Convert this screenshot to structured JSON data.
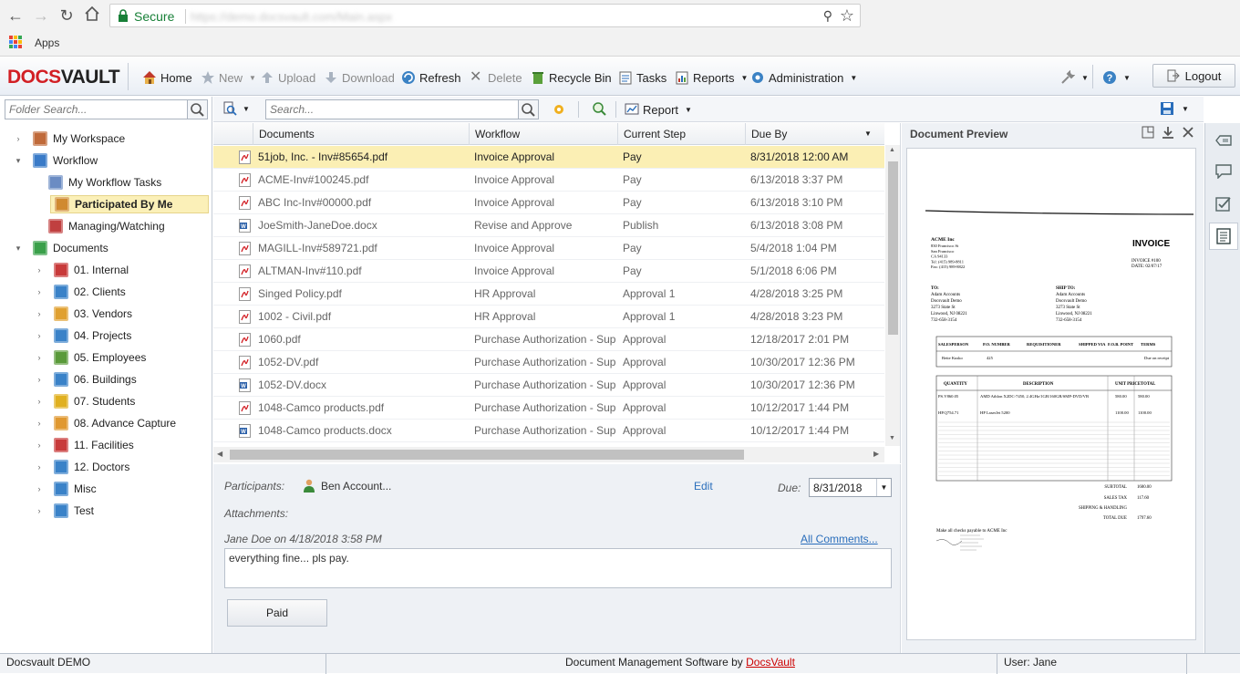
{
  "browser": {
    "secure_label": "Secure",
    "url": "https://demo.docsvault.com/Main.aspx",
    "apps_label": "Apps"
  },
  "app": {
    "logo_docs": "DOCS",
    "logo_vault": "VAULT",
    "toolbar": {
      "home": "Home",
      "new": "New",
      "upload": "Upload",
      "download": "Download",
      "refresh": "Refresh",
      "delete": "Delete",
      "recycle_bin": "Recycle Bin",
      "tasks": "Tasks",
      "reports": "Reports",
      "administration": "Administration",
      "logout": "Logout"
    }
  },
  "left_panel": {
    "search_placeholder": "Folder Search...",
    "tree": [
      {
        "label": "My Workspace",
        "arrow": "›",
        "level": 0,
        "color": "#c06a3a"
      },
      {
        "label": "Workflow",
        "arrow": "⌄",
        "level": 0,
        "color": "#3a7bc8"
      },
      {
        "label": "My Workflow Tasks",
        "arrow": "",
        "level": 1,
        "color": "#6b8cc3"
      },
      {
        "label": "Participated By Me",
        "arrow": "",
        "level": 1,
        "color": "#d08a30",
        "selected": true
      },
      {
        "label": "Managing/Watching",
        "arrow": "",
        "level": 1,
        "color": "#c04040"
      },
      {
        "label": "Documents",
        "arrow": "⌄",
        "level": 0,
        "color": "#3aa04a"
      },
      {
        "label": "01. Internal",
        "arrow": "›",
        "level": 1,
        "color": "#c83a3a"
      },
      {
        "label": "02. Clients",
        "arrow": "›",
        "level": 1,
        "color": "#3a82c8"
      },
      {
        "label": "03. Vendors",
        "arrow": "›",
        "level": 1,
        "color": "#e0a030"
      },
      {
        "label": "04. Projects",
        "arrow": "›",
        "level": 1,
        "color": "#3a82c8"
      },
      {
        "label": "05. Employees",
        "arrow": "›",
        "level": 1,
        "color": "#5a9a3a"
      },
      {
        "label": "06. Buildings",
        "arrow": "›",
        "level": 1,
        "color": "#3a82c8"
      },
      {
        "label": "07. Students",
        "arrow": "›",
        "level": 1,
        "color": "#e0b020"
      },
      {
        "label": "08. Advance Capture",
        "arrow": "›",
        "level": 1,
        "color": "#e09830"
      },
      {
        "label": "11. Facilities",
        "arrow": "›",
        "level": 1,
        "color": "#c83a3a"
      },
      {
        "label": "12. Doctors",
        "arrow": "›",
        "level": 1,
        "color": "#3a82c8"
      },
      {
        "label": "Misc",
        "arrow": "›",
        "level": 1,
        "color": "#3a82c8"
      },
      {
        "label": "Test",
        "arrow": "›",
        "level": 1,
        "color": "#3a82c8"
      }
    ]
  },
  "center_toolbar": {
    "search_placeholder": "Search...",
    "report_label": "Report"
  },
  "grid": {
    "columns": [
      "Documents",
      "Workflow",
      "Current Step",
      "Due By"
    ],
    "rows": [
      {
        "name": "51job, Inc. - Inv#85654.pdf",
        "type": "pdf",
        "workflow": "Invoice Approval",
        "step": "Pay",
        "due": "8/31/2018 12:00 AM",
        "selected": true
      },
      {
        "name": "ACME-Inv#100245.pdf",
        "type": "pdf",
        "workflow": "Invoice Approval",
        "step": "Pay",
        "due": "6/13/2018 3:37 PM"
      },
      {
        "name": "ABC Inc-Inv#00000.pdf",
        "type": "pdf",
        "workflow": "Invoice Approval",
        "step": "Pay",
        "due": "6/13/2018 3:10 PM"
      },
      {
        "name": "JoeSmith-JaneDoe.docx",
        "type": "docx",
        "workflow": "Revise and Approve",
        "step": "Publish",
        "due": "6/13/2018 3:08 PM"
      },
      {
        "name": "MAGILL-Inv#589721.pdf",
        "type": "pdf",
        "workflow": "Invoice Approval",
        "step": "Pay",
        "due": "5/4/2018 1:04 PM"
      },
      {
        "name": "ALTMAN-Inv#110.pdf",
        "type": "pdf",
        "workflow": "Invoice Approval",
        "step": "Pay",
        "due": "5/1/2018 6:06 PM"
      },
      {
        "name": "Singed Policy.pdf",
        "type": "pdf",
        "workflow": "HR Approval",
        "step": "Approval 1",
        "due": "4/28/2018 3:25 PM"
      },
      {
        "name": "1002 - Civil.pdf",
        "type": "pdf",
        "workflow": "HR Approval",
        "step": "Approval 1",
        "due": "4/28/2018 3:23 PM"
      },
      {
        "name": "1060.pdf",
        "type": "pdf",
        "workflow": "Purchase Authorization - Sup",
        "step": "Approval",
        "due": "12/18/2017 2:01 PM"
      },
      {
        "name": "1052-DV.pdf",
        "type": "pdf",
        "workflow": "Purchase Authorization - Sup",
        "step": "Approval",
        "due": "10/30/2017 12:36 PM"
      },
      {
        "name": "1052-DV.docx",
        "type": "docx",
        "workflow": "Purchase Authorization - Sup",
        "step": "Approval",
        "due": "10/30/2017 12:36 PM"
      },
      {
        "name": "1048-Camco products.pdf",
        "type": "pdf",
        "workflow": "Purchase Authorization - Sup",
        "step": "Approval",
        "due": "10/12/2017 1:44 PM"
      },
      {
        "name": "1048-Camco products.docx",
        "type": "docx",
        "workflow": "Purchase Authorization - Sup",
        "step": "Approval",
        "due": "10/12/2017 1:44 PM"
      }
    ]
  },
  "detail": {
    "participants_label": "Participants:",
    "participant_name": "Ben Account...",
    "edit_label": "Edit",
    "due_label": "Due:",
    "due_value": "8/31/2018",
    "attachments_label": "Attachments:",
    "comment_meta": "Jane Doe on 4/18/2018 3:58 PM",
    "all_comments_label": "All Comments...",
    "comment_text": "everything fine... pls pay.",
    "paid_button": "Paid"
  },
  "preview": {
    "title": "Document Preview",
    "invoice": {
      "heading": "INVOICE",
      "company": "ACME Inc",
      "address": [
        "830 Francisco St",
        "San Francisco",
        "CA 94133",
        "Tel: (415) 989-8811",
        "Fax: (415) 989-8822"
      ],
      "number": "INVOICE #100",
      "date": "DATE: 02/07/17",
      "to_label": "TO:",
      "to_lines": [
        "Adam Accounts",
        "Docsvault Demo",
        "3273 State St",
        "Linwood, NJ 08221",
        "732-658-3154"
      ],
      "ship_label": "SHIP TO:",
      "ship_lines": [
        "Adam Accounts",
        "Docsvault Demo",
        "3273 State St",
        "Linwood, NJ 08221",
        "732-658-3154"
      ],
      "head1": [
        "SALESPERSON",
        "P.O. NUMBER",
        "REQUISITIONER",
        "SHIPPED VIA",
        "F.O.B. POINT",
        "TERMS"
      ],
      "row1": [
        "Bette Kusko",
        "425",
        "",
        "",
        "",
        "Due on receipt"
      ],
      "head2": [
        "QUANTITY",
        "DESCRIPTION",
        "UNIT PRICE",
        "TOTAL"
      ],
      "items": [
        {
          "qty": "PS.V860.05",
          "desc": "AMD Athlon X2DC-7450, 2.4GHz/1GB/160GB/SMP-DVD/VB",
          "unit": "580.00",
          "total": "580.00"
        },
        {
          "qty": "HP.Q754.71",
          "desc": "HP LaserJet 5200",
          "unit": "1100.00",
          "total": "1100.00"
        }
      ],
      "subtotal_label": "SUBTOTAL",
      "subtotal": "1680.00",
      "tax_label": "SALES TAX",
      "tax": "117.60",
      "shipping_label": "SHIPPING & HANDLING",
      "shipping": "",
      "total_label": "TOTAL DUE",
      "total": "1797.60",
      "footer": "Make all checks payable to ACME Inc"
    }
  },
  "status": {
    "left": "Docsvault DEMO",
    "center": "Document Management Software by ",
    "center_link": "DocsVault",
    "right": "User: Jane"
  },
  "colors": {
    "selected_row": "#fbefb4",
    "accent_red": "#d21f24",
    "link_blue": "#2a6ebb"
  }
}
